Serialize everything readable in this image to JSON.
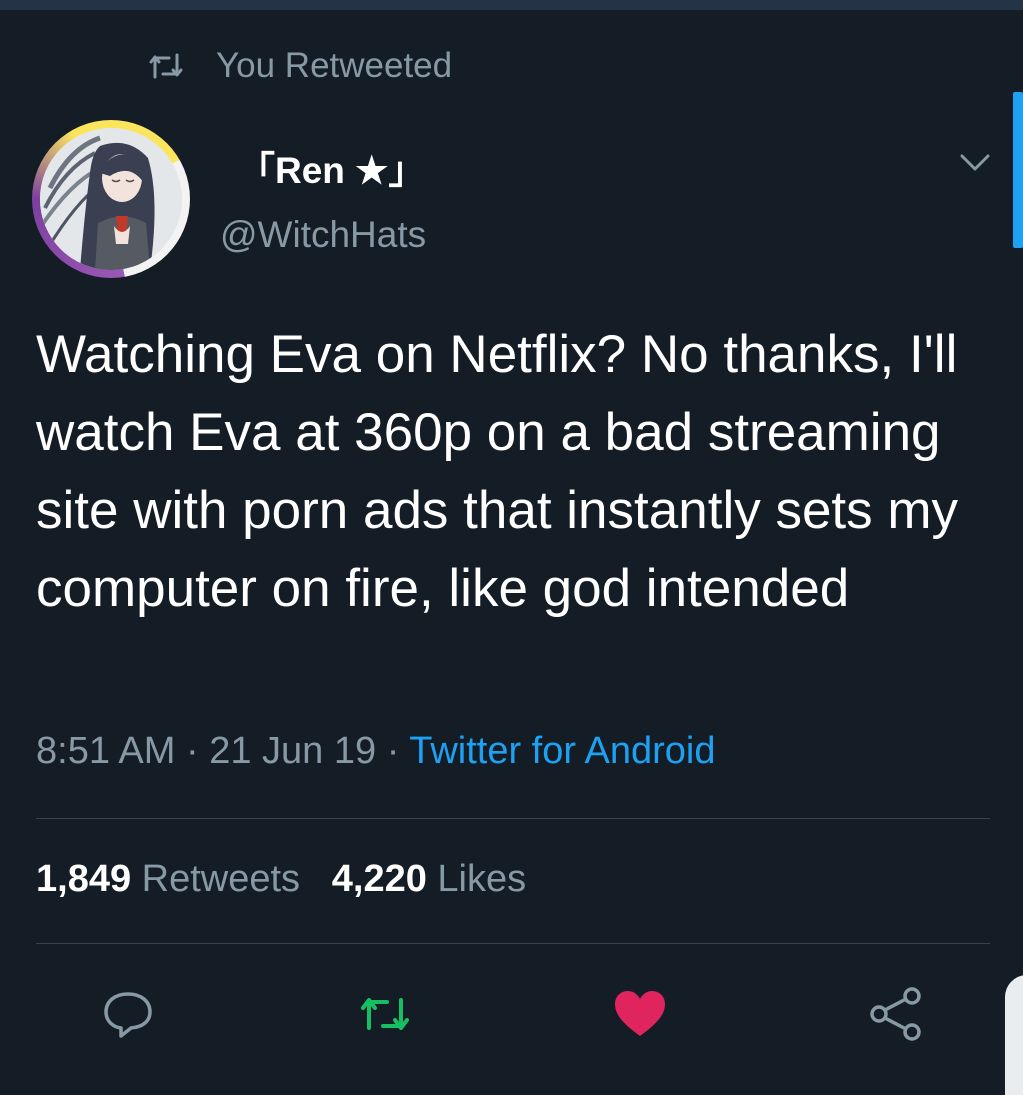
{
  "retweet_context": {
    "label": "You Retweeted",
    "icon": "retweet-icon"
  },
  "author": {
    "display_name": "「Ren ★」",
    "handle": "@WitchHats",
    "avatar": "avatar-image"
  },
  "tweet": {
    "text": "Watching Eva on Netflix? No thanks, I'll watch Eva at 360p on a bad streaming site with porn ads that instantly sets my computer on fire, like god intended",
    "time": "8:51 AM",
    "date": "21 Jun 19",
    "separator": "·",
    "source": "Twitter for Android"
  },
  "stats": {
    "retweets_count": "1,849",
    "retweets_label": "Retweets",
    "likes_count": "4,220",
    "likes_label": "Likes"
  },
  "actions": {
    "reply_icon": "reply-icon",
    "retweet_icon": "retweet-icon",
    "like_icon": "heart-icon",
    "share_icon": "share-icon"
  },
  "colors": {
    "background": "#141d26",
    "secondary_text": "#8899a6",
    "link": "#1da1f2",
    "retweeted": "#17bf63",
    "liked": "#e0245e"
  }
}
